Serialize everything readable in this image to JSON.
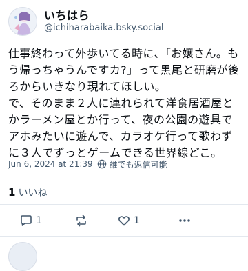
{
  "post": {
    "author_name": "いちはら",
    "handle": "@ichiharabaika.bsky.social",
    "text": "仕事終わって外歩いてる時に、「お嬢さん。もう帰っちゃうんですカ?」って黒尾と研磨が後ろからいきなり現れてほしい。\nで、そのまま２人に連れられて洋食居酒屋とかラーメン屋とか行って、夜の公園の遊具でアホみたいに遊んで、カラオケ行って歌わずに３人でずっとゲームできる世界線どこ。",
    "timestamp": "Jun 6, 2024 at 21:39",
    "reply_setting": "誰でも返信可能",
    "like_count": "1",
    "like_label": "いいね"
  },
  "actions": {
    "reply_count": "1",
    "repost_count": "",
    "like_count": "1"
  },
  "icons": {
    "avatar": "avatar-illustration",
    "globe": "globe-icon",
    "reply": "speech-bubble-icon",
    "repost": "repost-arrows-icon",
    "like": "heart-icon",
    "more": "more-dots-icon"
  },
  "colors": {
    "text": "#0b0f14",
    "muted": "#42576c",
    "divider": "#e3e8ee"
  }
}
